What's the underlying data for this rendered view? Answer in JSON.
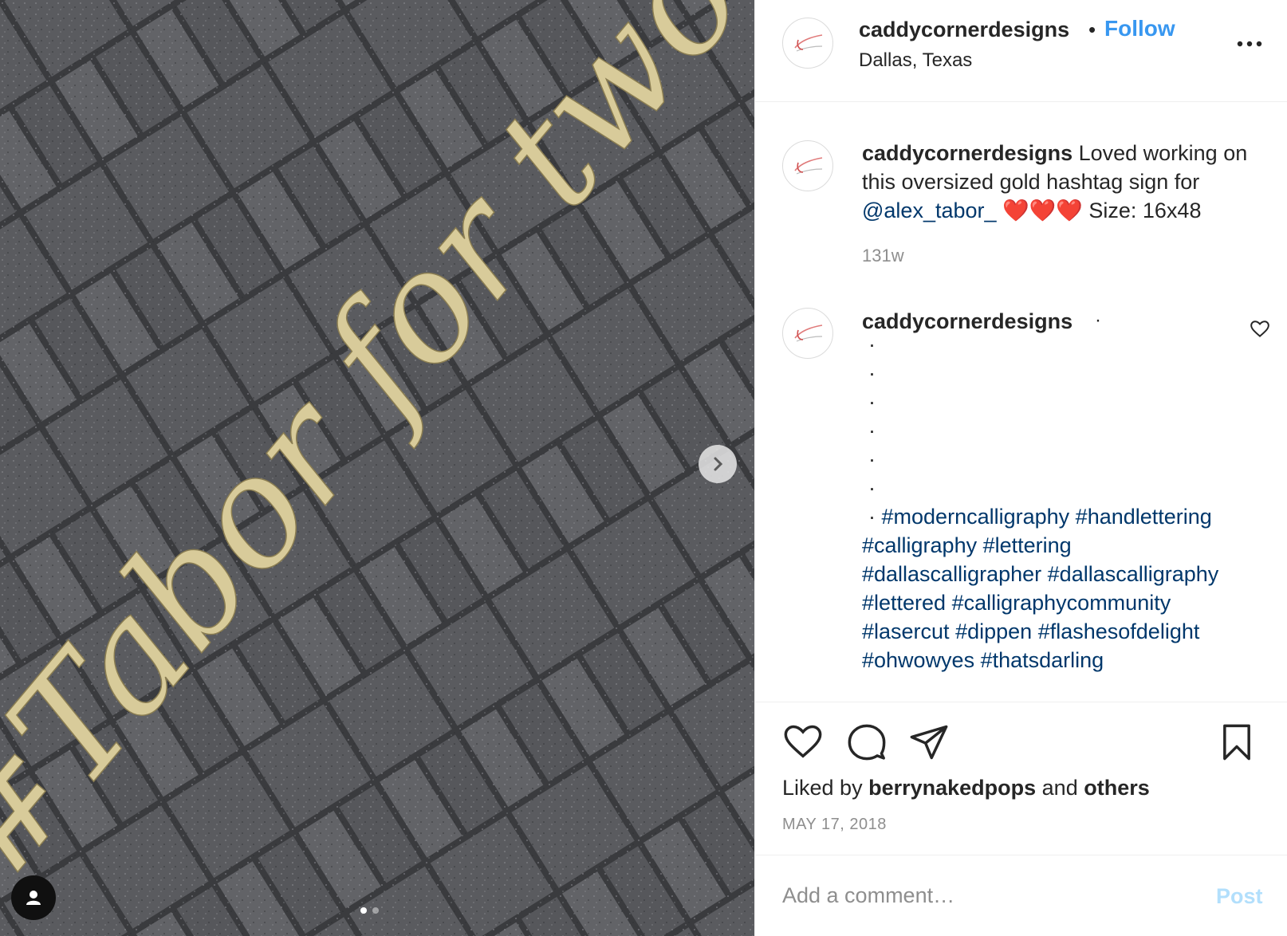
{
  "post": {
    "username": "caddycornerdesigns",
    "separator": "•",
    "follow_label": "Follow",
    "location": "Dallas, Texas",
    "more_icon": "more-horizontal-icon"
  },
  "photo": {
    "sign_text": "#Tabor for two",
    "carousel_position": 1,
    "carousel_count": 2
  },
  "caption": {
    "username": "caddycornerdesigns",
    "text_before": " Loved working on this oversized gold hashtag sign for ",
    "mention": "@alex_tabor_",
    "hearts": " ❤️❤️❤️ ",
    "text_after": "Size: 16x48",
    "age": "131w"
  },
  "comment": {
    "username": "caddycornerdesigns",
    "user_dot": "·",
    "bullets": [
      "·",
      "·",
      "·",
      "·",
      "·",
      "·"
    ],
    "last_bullet": "·",
    "hashtags": [
      "#moderncalligraphy",
      "#handlettering",
      "#calligraphy",
      "#lettering",
      "#dallascalligrapher",
      "#dallascalligraphy",
      "#lettered",
      "#calligraphycommunity",
      "#lasercut",
      "#dippen",
      "#flashesofdelight",
      "#ohwowyes",
      "#thatsdarling"
    ]
  },
  "actions": {
    "liked_prefix": "Liked by ",
    "liked_user": "berrynakedpops",
    "liked_mid": " and ",
    "liked_others": "others",
    "date": "MAY 17, 2018"
  },
  "comment_box": {
    "placeholder": "Add a comment…",
    "post_label": "Post"
  },
  "colors": {
    "link_blue": "#3897f0",
    "hashtag_navy": "#00376b",
    "muted": "#8e8e8e",
    "post_disabled": "#b2dffc",
    "gold_sign": "#d8cb9a"
  }
}
